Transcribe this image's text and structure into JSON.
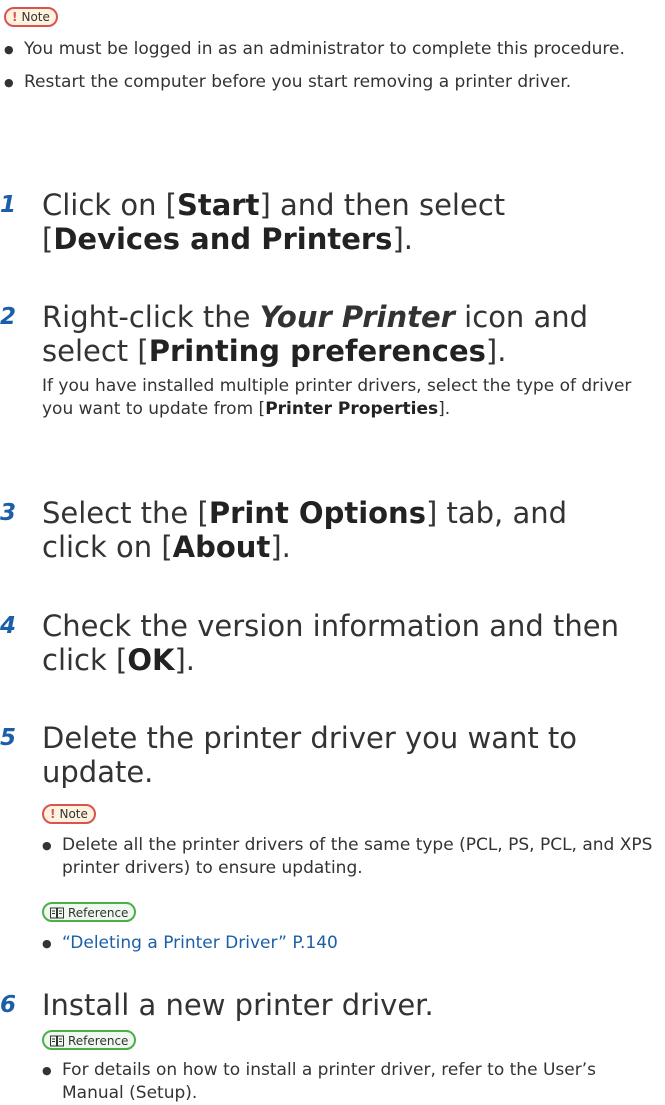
{
  "note_label": "Note",
  "reference_label": "Reference",
  "intro_notes": [
    "You must be logged in as an administrator to complete this procedure.",
    "Restart the computer before you start removing a printer driver."
  ],
  "steps": [
    {
      "num": "1",
      "t1": "Click on [",
      "b1": "Start",
      "t2": "] and then select",
      "t3": "[",
      "b2": "Devices and Printers",
      "t4": "]."
    },
    {
      "num": "2",
      "t1": "Right-click the ",
      "i1": "Your Printer",
      "t2": " icon and",
      "t3": "select [",
      "b1": "Printing preferences",
      "t4": "].",
      "body_t1": "If you have installed multiple printer drivers, select the type of driver you want to update from [",
      "body_b1": "Printer Properties",
      "body_t2": "]."
    },
    {
      "num": "3",
      "t1": "Select the [",
      "b1": "Print Options",
      "t2": "] tab, and",
      "t3": "click on [",
      "b2": "About",
      "t4": "]."
    },
    {
      "num": "4",
      "t1": "Check the version information and then",
      "t2": "click [",
      "b1": "OK",
      "t3": "]."
    },
    {
      "num": "5",
      "t1": "Delete the printer driver you want to",
      "t2": "update.",
      "note": "Delete all the printer drivers of the same type (PCL, PS, PCL, and XPS printer drivers) to ensure updating.",
      "reference": "“Deleting a Printer Driver” P.140"
    },
    {
      "num": "6",
      "t1": "Install a new printer driver.",
      "reference": "For details on how to install a printer driver, refer to the User’s Manual (Setup)."
    }
  ]
}
